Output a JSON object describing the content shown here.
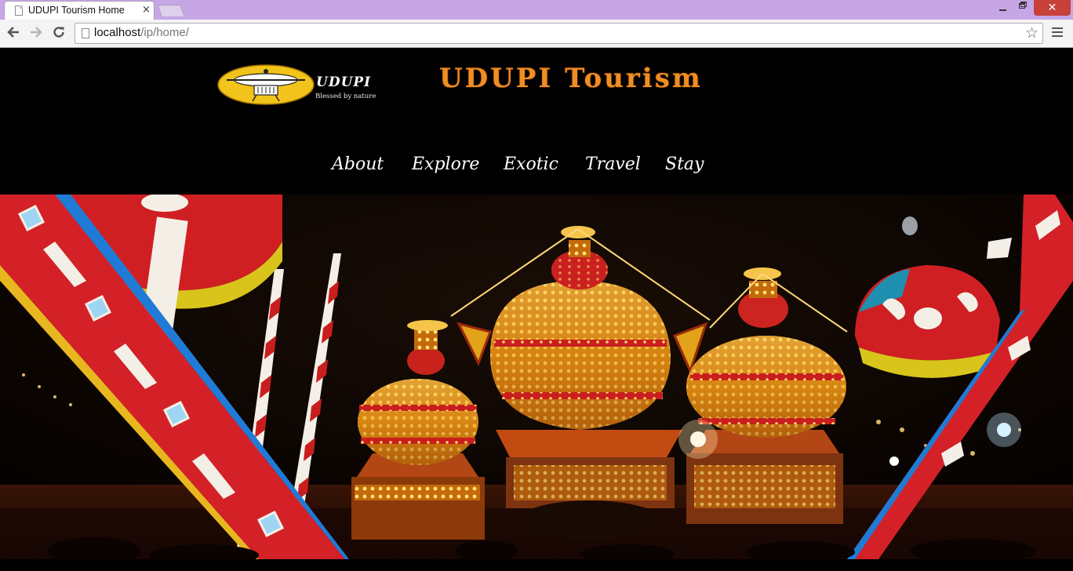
{
  "browser": {
    "tab_title": "UDUPI Tourism Home",
    "tab_close": "×",
    "address_host": "localhost",
    "address_path": "/ip/home/",
    "window_close": "✕",
    "icons": [
      "page-icon",
      "back-arrow-icon",
      "forward-arrow-icon",
      "reload-icon",
      "star-icon",
      "menu-icon",
      "minimize-icon",
      "restore-icon",
      "close-icon"
    ]
  },
  "header": {
    "logo_text": "UDUPI",
    "logo_tagline": "Blessed by nature",
    "title": "UDUPI Tourism",
    "title_color": "#f08d23"
  },
  "nav": {
    "items": [
      {
        "label": "About"
      },
      {
        "label": "Explore"
      },
      {
        "label": "Exotic"
      },
      {
        "label": "Travel"
      },
      {
        "label": "Stay"
      }
    ]
  },
  "banner": {
    "subject": "temple-chariots-festival-photo",
    "colors": {
      "sky": "#0a0503",
      "gold": "#e8a01c",
      "red": "#d0212b",
      "flag_white": "#f3efe6"
    }
  }
}
